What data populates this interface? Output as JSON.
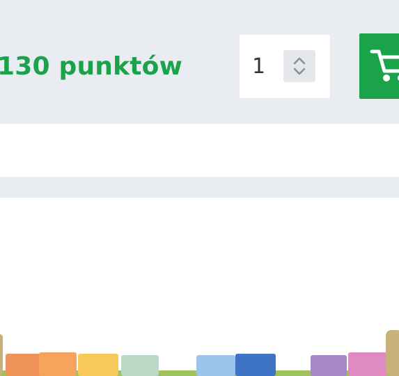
{
  "offer": {
    "points_label": "130 punktów"
  },
  "quantity": {
    "value": "1"
  },
  "icons": {
    "stepper": "chevron-up-down-icon",
    "cart": "shopping-cart-icon"
  },
  "colors": {
    "accent": "#1aa34a",
    "panel_background": "#e9edf2"
  }
}
